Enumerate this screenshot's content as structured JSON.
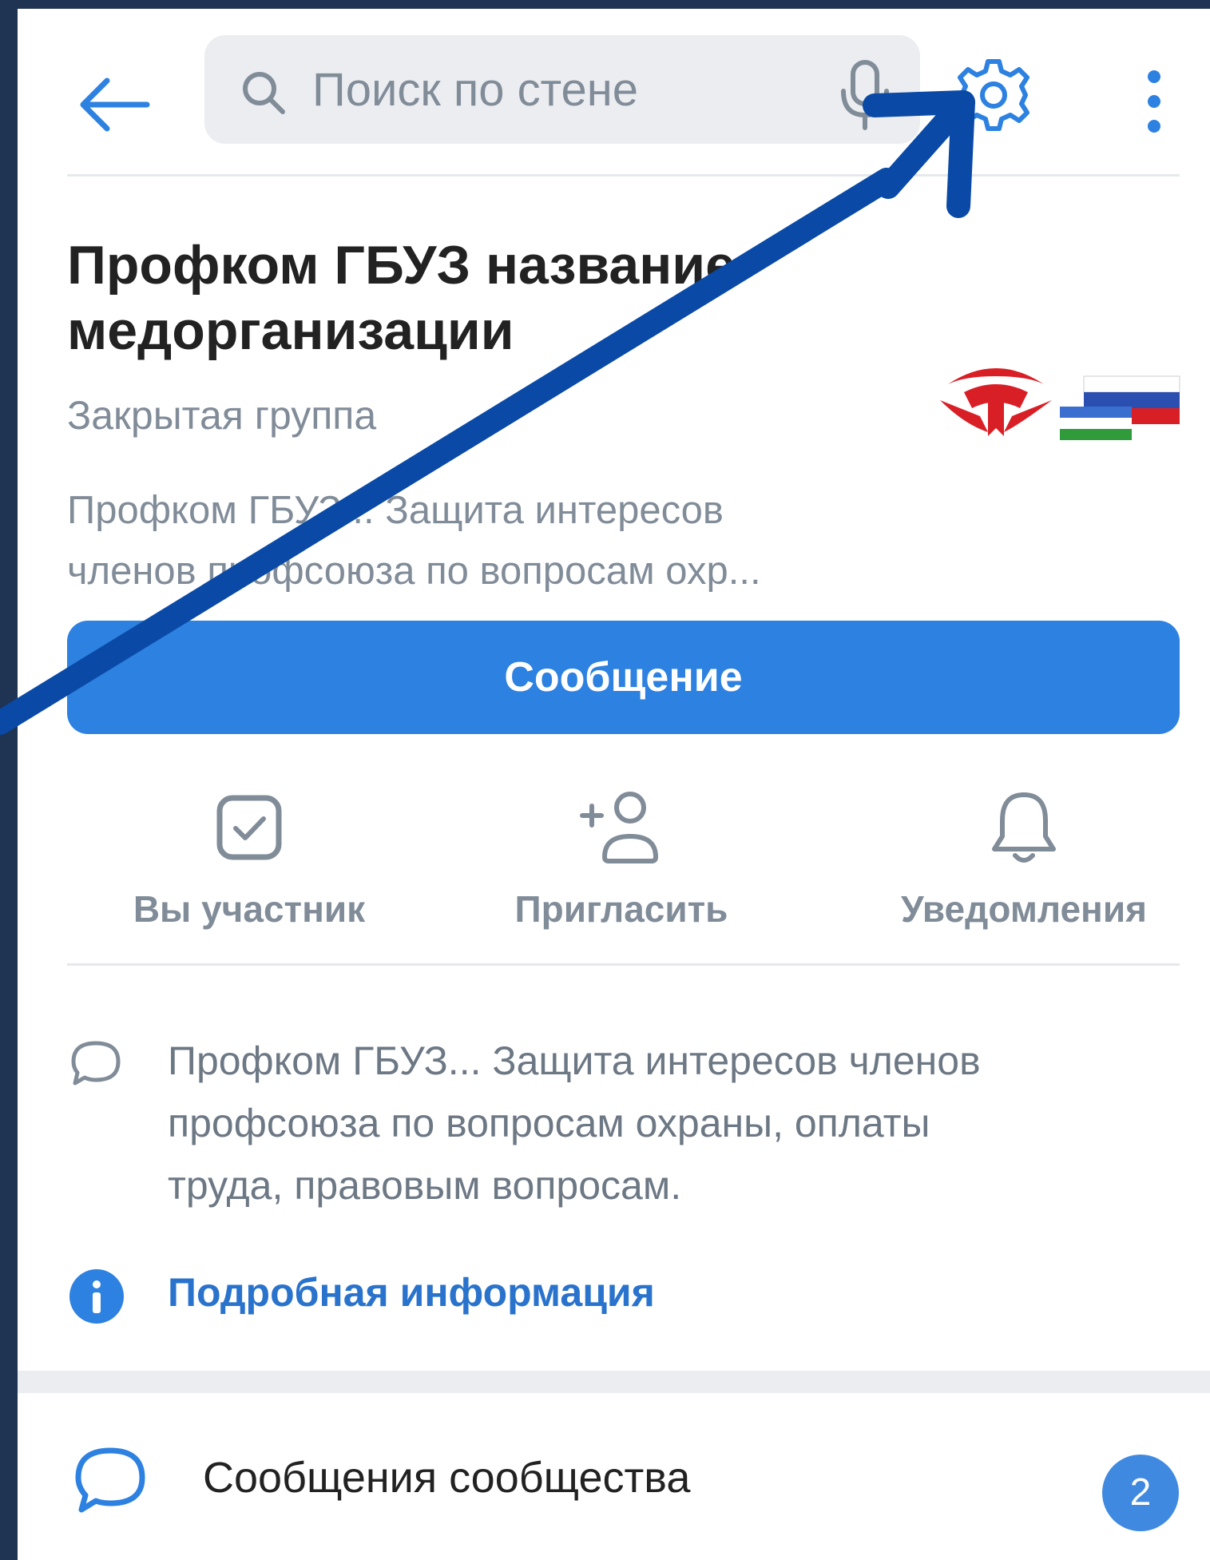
{
  "colors": {
    "frame": "#1f3352",
    "accent": "#2d81e0",
    "link": "#2a73cc",
    "annotation_arrow": "#0a4aa6",
    "secondary_text": "#818c99"
  },
  "header": {
    "back_icon": "arrow-left-icon",
    "search_placeholder": "Поиск по стене",
    "search_icon": "search-icon",
    "mic_icon": "microphone-icon",
    "settings_icon": "gear-icon",
    "more_icon": "more-vertical-icon"
  },
  "group": {
    "title_line1": "Профком ГБУЗ название",
    "title_line2": "медорганизации",
    "type": "Закрытая группа",
    "description_line1": "Профком ГБУЗ... Защита интересов",
    "description_line2": "членов профсоюза по вопросам охр..."
  },
  "message_button": "Сообщение",
  "actions": [
    {
      "label": "Вы участник",
      "icon": "checkbox-checked-icon"
    },
    {
      "label": "Пригласить",
      "icon": "add-user-icon"
    },
    {
      "label": "Уведомления",
      "icon": "bell-icon"
    }
  ],
  "about": {
    "icon": "comment-icon",
    "line1": "Профком ГБУЗ... Защита интересов членов",
    "line2": "профсоюза по вопросам охраны, оплаты",
    "line3": "труда, правовым вопросам."
  },
  "details_link": {
    "label": "Подробная информация",
    "icon": "info-icon"
  },
  "community_messages": {
    "label": "Сообщения сообщества",
    "count": "2",
    "icon": "message-bubble-icon"
  }
}
